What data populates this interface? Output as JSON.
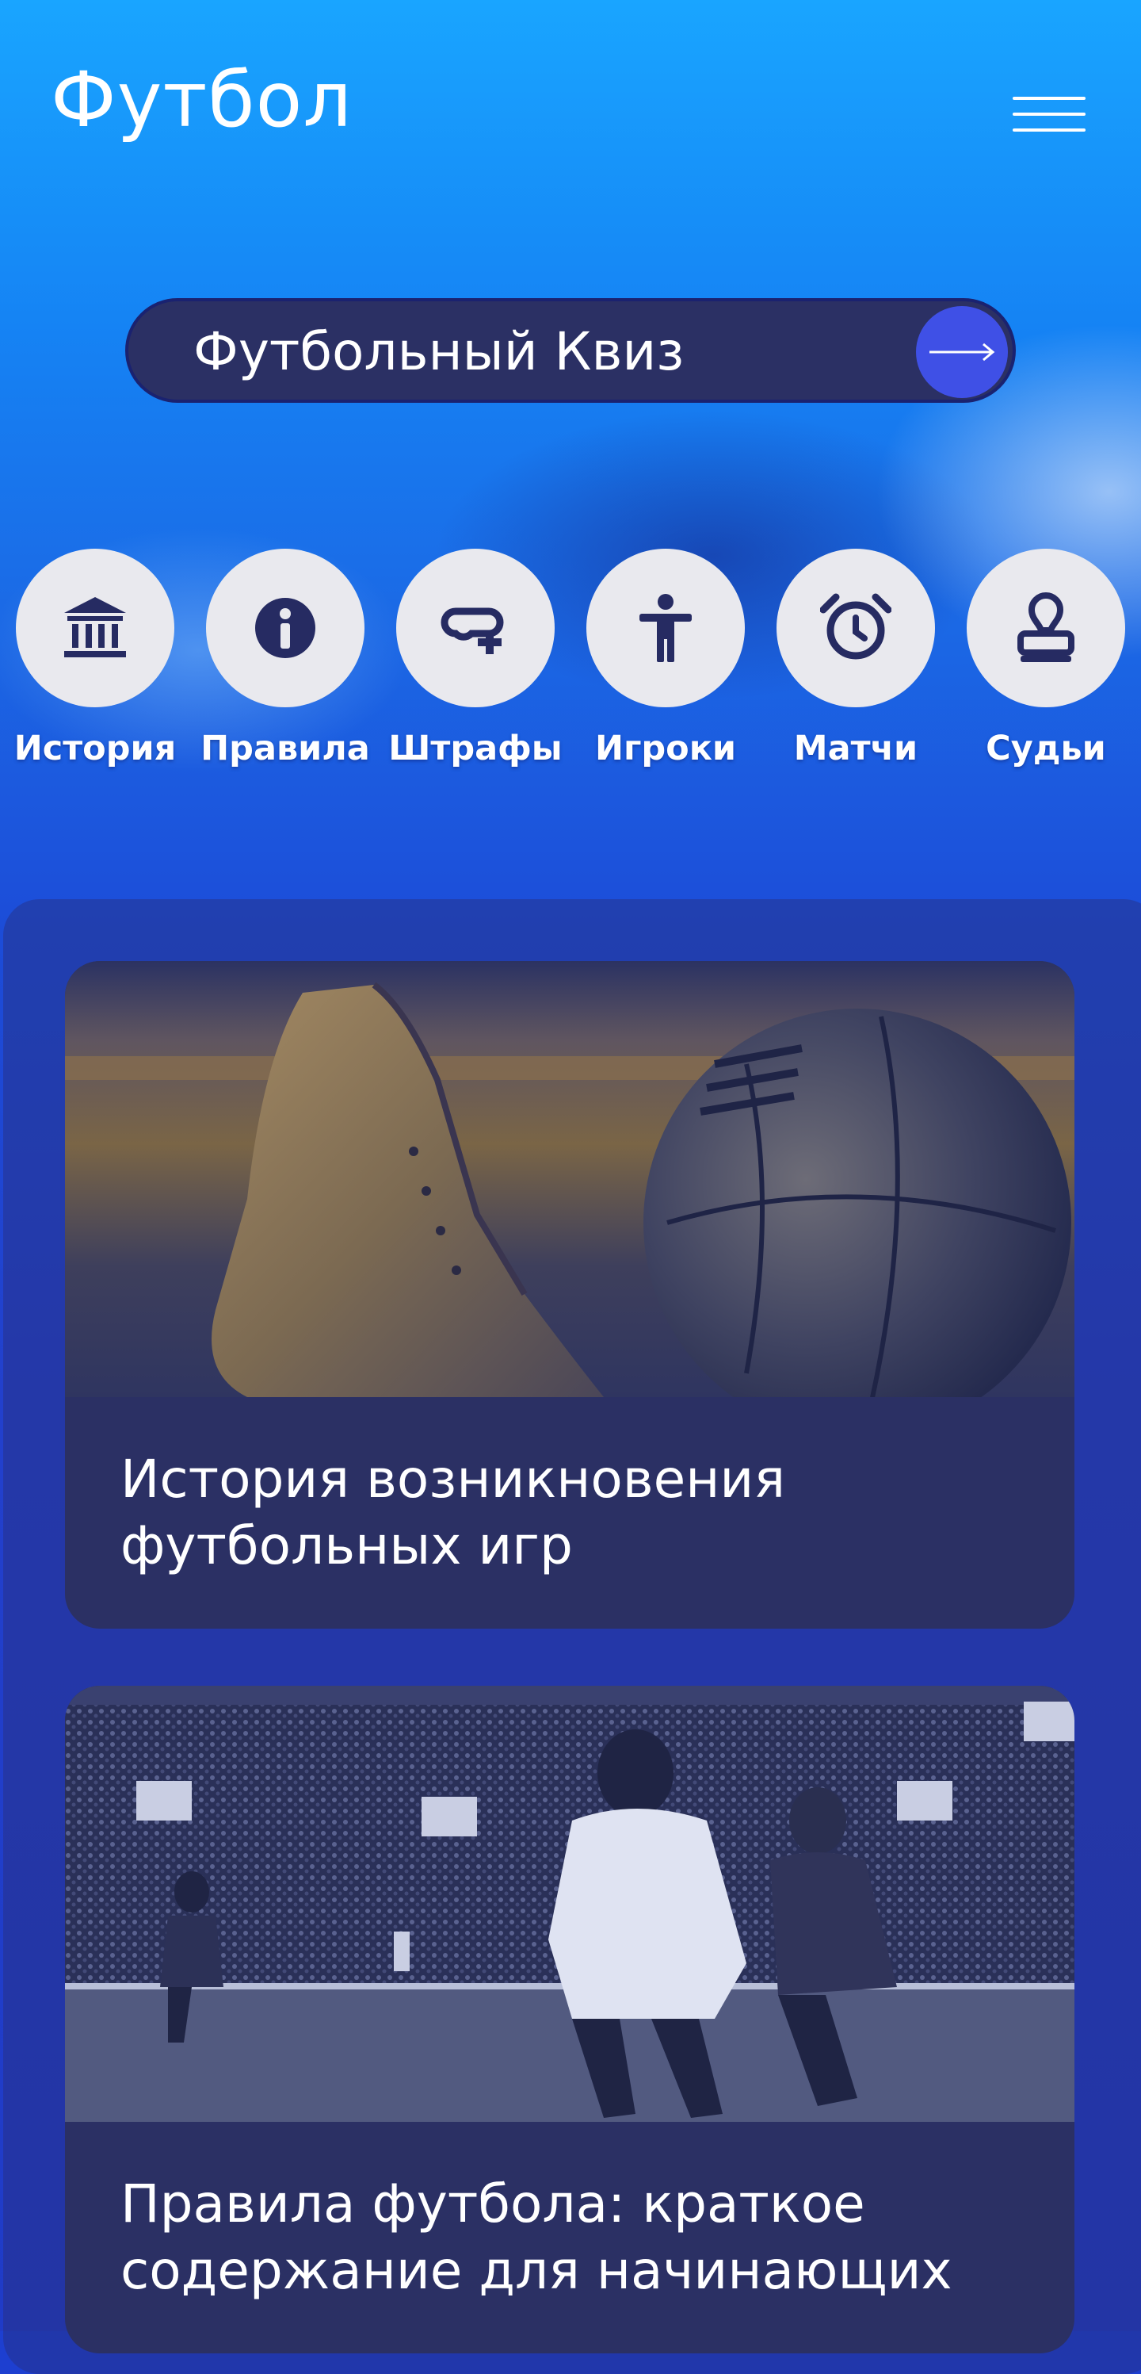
{
  "header": {
    "title": "Футбол"
  },
  "quiz": {
    "label": "Футбольный Квиз"
  },
  "categories": [
    {
      "label": "История",
      "icon": "museum-icon"
    },
    {
      "label": "Правила",
      "icon": "info-icon"
    },
    {
      "label": "Штрафы",
      "icon": "whistle-icon"
    },
    {
      "label": "Игроки",
      "icon": "person-icon"
    },
    {
      "label": "Матчи",
      "icon": "alarm-clock-icon"
    },
    {
      "label": "Судьи",
      "icon": "stamp-icon"
    }
  ],
  "articles": [
    {
      "title": "История возникновения футбольных игр"
    },
    {
      "title": "Правила футбола: краткое содержание для начинающих"
    }
  ],
  "colors": {
    "accent": "#3f50e6",
    "card_bg": "#2b3064",
    "icon_circle": "#e9e9ee",
    "icon_fg": "#262b62"
  }
}
